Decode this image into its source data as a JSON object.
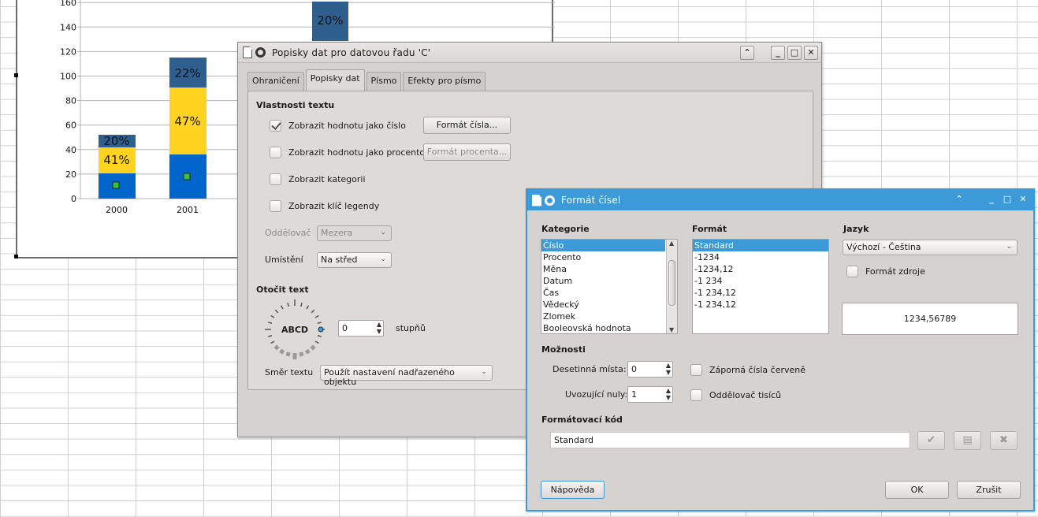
{
  "chart": {
    "y_ticks": [
      "0",
      "20",
      "40",
      "60",
      "80",
      "100",
      "120",
      "140",
      "160"
    ],
    "x_labels": [
      "2000",
      "2001"
    ],
    "bar_labels_2000": [
      "20%",
      "41%"
    ],
    "bar_labels_2001": [
      "22%",
      "47%"
    ],
    "tall_bar_label": "20%",
    "colors": {
      "blue": "#0066cc",
      "yellow": "#ffd320",
      "dark": "#2f5f8f"
    }
  },
  "chart_data": {
    "type": "bar",
    "categories": [
      "2000",
      "2001"
    ],
    "ylim": [
      0,
      160
    ],
    "series": [
      {
        "values": [
          20,
          35
        ]
      },
      {
        "values": [
          21,
          54
        ]
      },
      {
        "values": [
          10,
          25
        ]
      }
    ],
    "data_labels": {
      "2000": [
        "20%",
        "41%"
      ],
      "2001": [
        "22%",
        "47%"
      ]
    }
  },
  "dialog1": {
    "title": "Popisky dat pro datovou řadu 'C'",
    "tabs": [
      "Ohraničení",
      "Popisky dat",
      "Písmo",
      "Efekty pro písmo"
    ],
    "section_text": "Vlastnosti textu",
    "show_value_number": "Zobrazit hodnotu jako číslo",
    "show_value_percent": "Zobrazit hodnotu jako procento",
    "show_category": "Zobrazit kategorii",
    "show_legend_key": "Zobrazit klíč legendy",
    "number_format_btn": "Formát čísla...",
    "percent_format_btn": "Formát procenta...",
    "separator_label": "Oddělovač",
    "separator_value": "Mezera",
    "placement_label": "Umístění",
    "placement_value": "Na střed",
    "rotate_section": "Otočit text",
    "dial_text": "ABCD",
    "degrees_value": "0",
    "degrees_label": "stupňů",
    "text_direction_label": "Směr textu",
    "text_direction_value": "Použít nastavení nadřazeného objektu"
  },
  "dialog2": {
    "title": "Formát čísel",
    "category_label": "Kategorie",
    "categories": [
      "Číslo",
      "Procento",
      "Měna",
      "Datum",
      "Čas",
      "Vědecký",
      "Zlomek",
      "Booleovská hodnota"
    ],
    "format_label": "Formát",
    "formats": [
      "Standard",
      "-1234",
      "-1234,12",
      "-1 234",
      "-1 234,12",
      "-1 234,12"
    ],
    "language_label": "Jazyk",
    "language_value": "Výchozí - Čeština",
    "source_format": "Formát zdroje",
    "preview": "1234,56789",
    "options_label": "Možnosti",
    "decimal_label": "Desetinná místa:",
    "decimal_value": "0",
    "leading_label": "Uvozující nuly:",
    "leading_value": "1",
    "negative_red": "Záporná čísla červeně",
    "thousands_sep": "Oddělovač tisíců",
    "format_code_label": "Formátovací kód",
    "format_code_value": "Standard",
    "help_btn": "Nápověda",
    "ok_btn": "OK",
    "cancel_btn": "Zrušit"
  }
}
